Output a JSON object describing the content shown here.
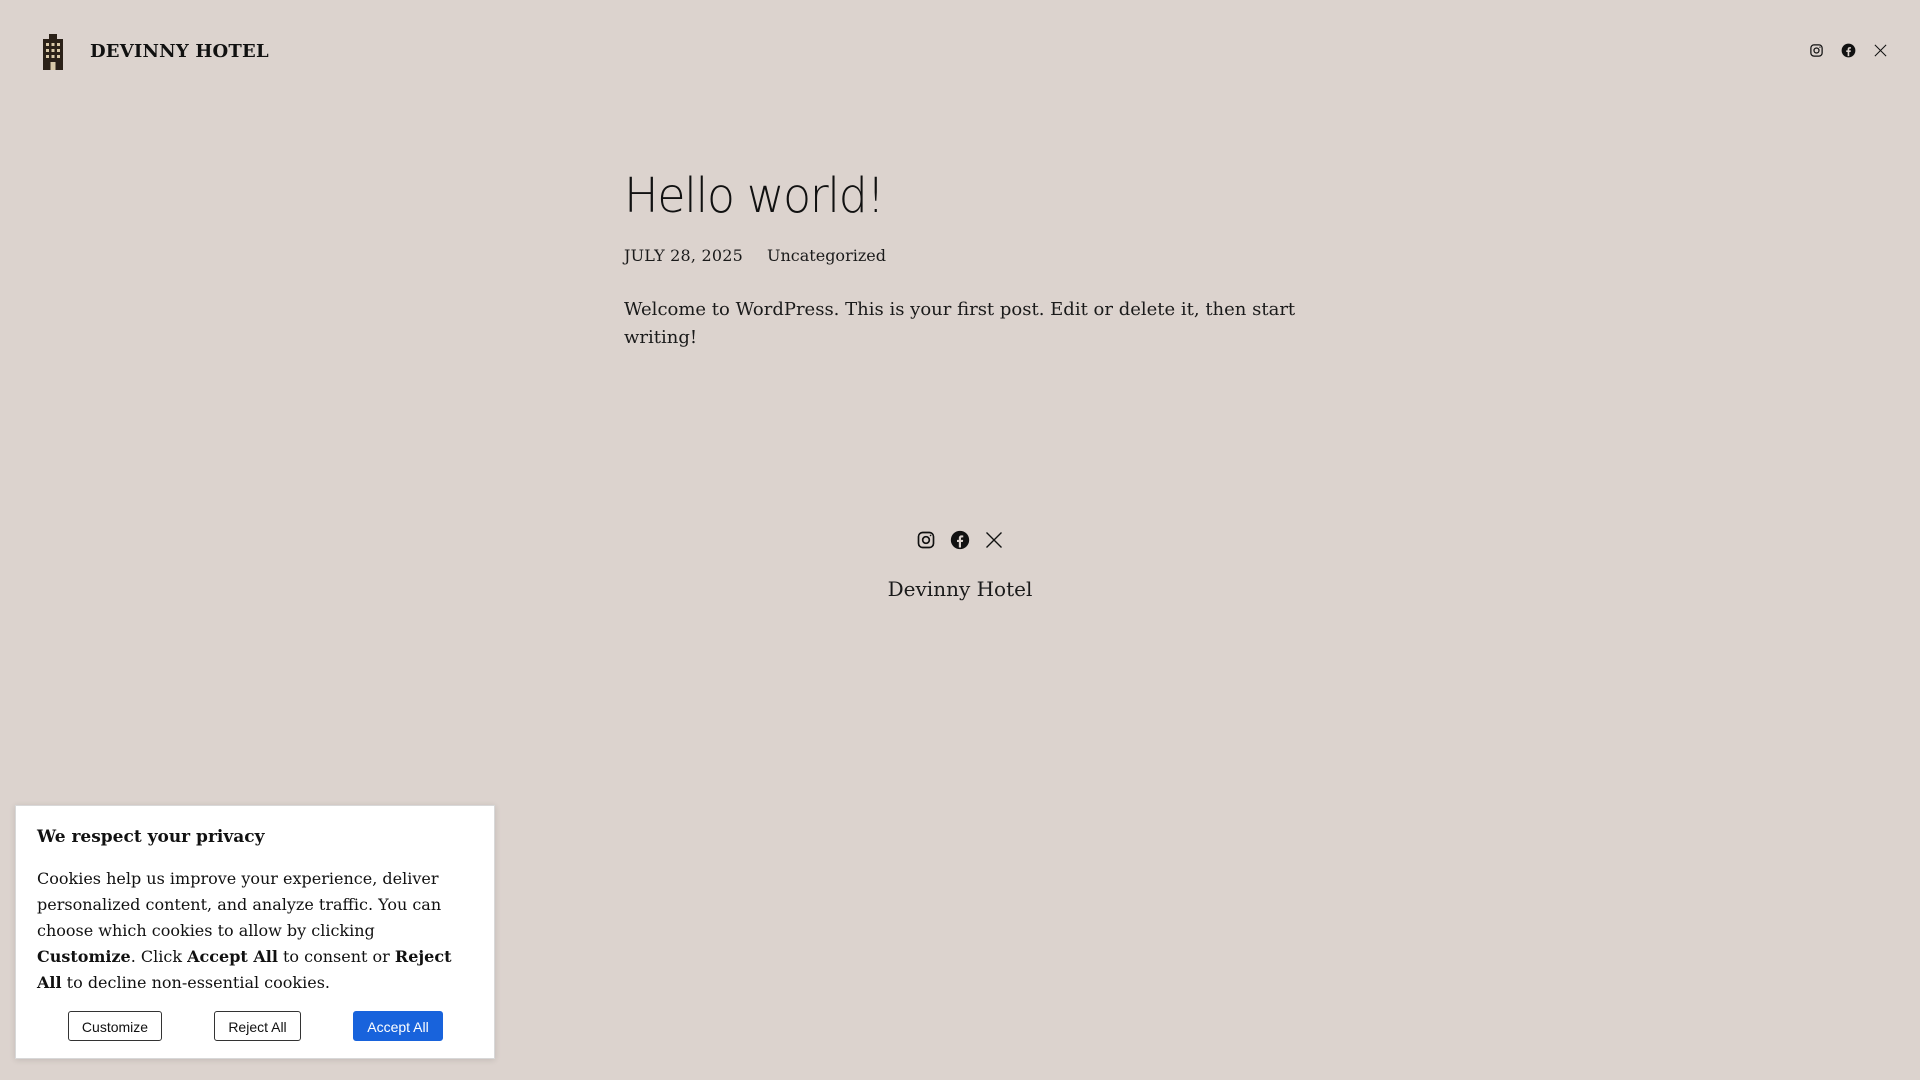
{
  "header": {
    "logo_icon": "building-icon",
    "site_title": "DEVINNY HOTEL",
    "social": [
      {
        "name": "instagram",
        "icon": "instagram-icon"
      },
      {
        "name": "facebook",
        "icon": "facebook-icon"
      },
      {
        "name": "x",
        "icon": "x-icon"
      }
    ]
  },
  "post": {
    "title": "Hello world!",
    "date": "JULY 28, 2025",
    "category": "Uncategorized",
    "content": "Welcome to WordPress. This is your first post. Edit or delete it, then start writing!"
  },
  "footer": {
    "social": [
      {
        "name": "instagram",
        "icon": "instagram-icon"
      },
      {
        "name": "facebook",
        "icon": "facebook-icon"
      },
      {
        "name": "x",
        "icon": "x-icon"
      }
    ],
    "site_title": "Devinny Hotel"
  },
  "cookie_banner": {
    "title": "We respect your privacy",
    "text_part1": "Cookies help us improve your experience, deliver personalized content, and analyze traffic. You can choose which cookies to allow by clicking ",
    "bold_customize": "Customize",
    "text_part2": ". Click ",
    "bold_accept": "Accept All",
    "text_part3": " to consent or ",
    "bold_reject": "Reject All",
    "text_part4": " to decline non-essential cookies.",
    "buttons": {
      "customize": "Customize",
      "reject": "Reject All",
      "accept": "Accept All"
    },
    "accent_color": "#1863dc"
  },
  "colors": {
    "background": "#dcd3ce",
    "text": "#1a1a1a"
  }
}
